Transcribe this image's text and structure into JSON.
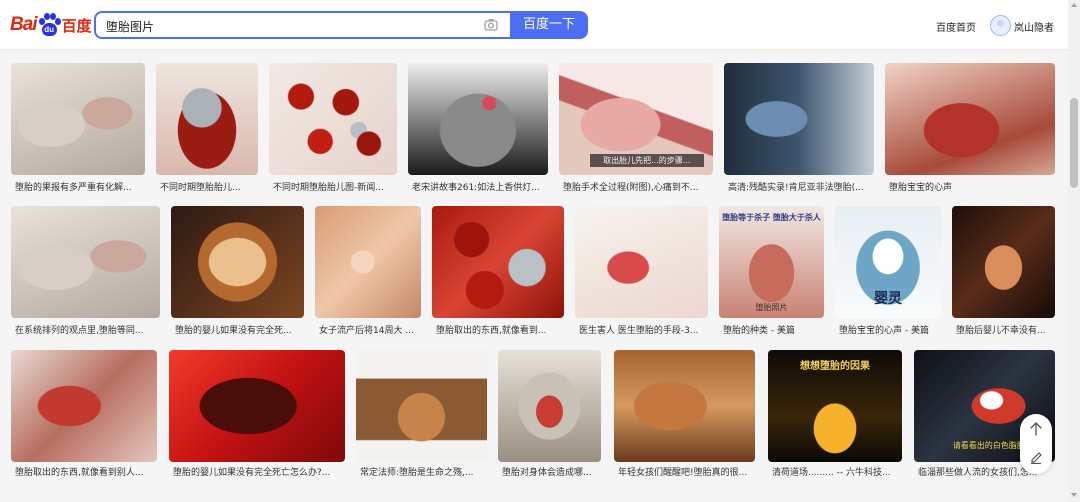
{
  "header": {
    "logo_bai": "Bai",
    "logo_du": "du",
    "logo_cn": "百度",
    "search_value": "堕胎图片",
    "search_button": "百度一下",
    "home_link": "百度首页",
    "username": "岚山隐者"
  },
  "icons": {
    "camera": "camera-icon",
    "back_to_top": "arrow-up-icon",
    "feedback": "edit-icon",
    "avatar": "avatar-icon"
  },
  "colors": {
    "brand_red": "#de2910",
    "brand_blue": "#2932e1",
    "search_blue": "#4e6ef2"
  },
  "results": [
    {
      "caption": "堕胎的果报有多严重有化解..."
    },
    {
      "caption": "不同时期堕胎胎儿..."
    },
    {
      "caption": "不同时期堕胎胎儿图-新闻..."
    },
    {
      "caption": "老宋讲故事261:如法上香供灯..."
    },
    {
      "caption": "堕胎手术全过程(附图),心痛到不..."
    },
    {
      "caption": "高清:残酷实录!肯尼亚非法堕胎(..."
    },
    {
      "caption": "堕胎宝宝的心声"
    },
    {
      "caption": "在系统排列的观点里,堕胎等同..."
    },
    {
      "caption": "堕胎的婴儿如果没有完全死..."
    },
    {
      "caption": "女子流产后将14周大 ..."
    },
    {
      "caption": "堕胎取出的东西,就像看到..."
    },
    {
      "caption": "医生害人 医生堕胎的手段-3..."
    },
    {
      "caption": "堕胎的种类 - 美篇",
      "overlay_a": "堕胎等于杀子",
      "overlay_b": "堕胎大于杀人",
      "overlay_c": "堕胎照片"
    },
    {
      "caption": "堕胎宝宝的心声 - 美篇",
      "overlay": "婴灵"
    },
    {
      "caption": "堕胎后婴儿不幸没有..."
    },
    {
      "caption": "堕胎取出的东西,就像看到别人..."
    },
    {
      "caption": "堕胎的婴儿如果没有完全死亡怎么办?..."
    },
    {
      "caption": "常定法师:堕胎是生命之殇,..."
    },
    {
      "caption": "堕胎对身体会造成哪..."
    },
    {
      "caption": "年轻女孩们醒醒吧!堕胎真的很..."
    },
    {
      "caption": "清荷道场......... -- 六牛科技..."
    },
    {
      "caption": "临淄那些做人流的女孩们,怎...",
      "overlay": "请看看出的白色脂肪"
    }
  ],
  "result_overlays": {
    "r4": "取出胎儿先把...的步骤...",
    "r20": "想想堕胎的因果"
  }
}
